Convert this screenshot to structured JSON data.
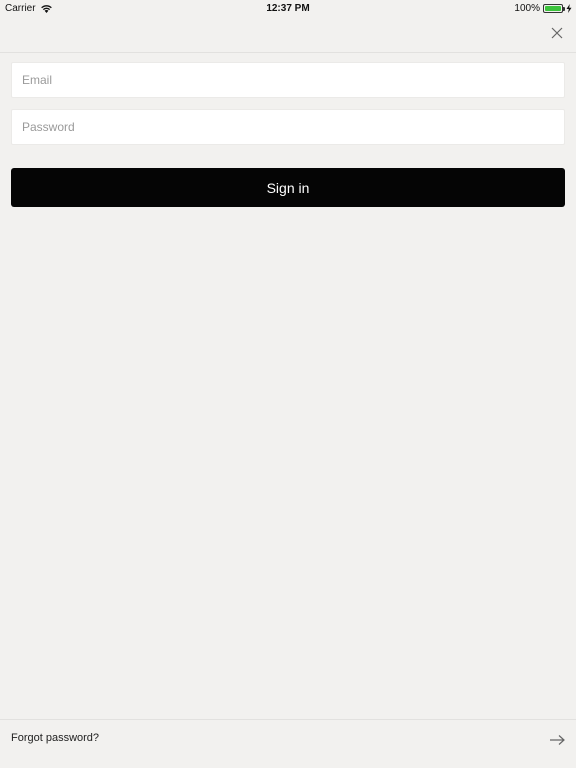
{
  "status_bar": {
    "carrier": "Carrier",
    "time": "12:37 PM",
    "battery_percent": "100%",
    "battery_color": "#3cc33c",
    "icons": [
      "wifi-icon",
      "battery-icon",
      "charging-icon"
    ]
  },
  "header": {
    "close_icon": "close-icon"
  },
  "form": {
    "email_placeholder": "Email",
    "email_value": "",
    "password_placeholder": "Password",
    "password_value": "",
    "signin_label": "Sign in"
  },
  "footer": {
    "forgot_label": "Forgot password?",
    "arrow_icon": "arrow-right-icon"
  },
  "colors": {
    "background": "#f2f1ef",
    "button": "#050505",
    "button_text": "#ffffff",
    "field": "#ffffff"
  }
}
